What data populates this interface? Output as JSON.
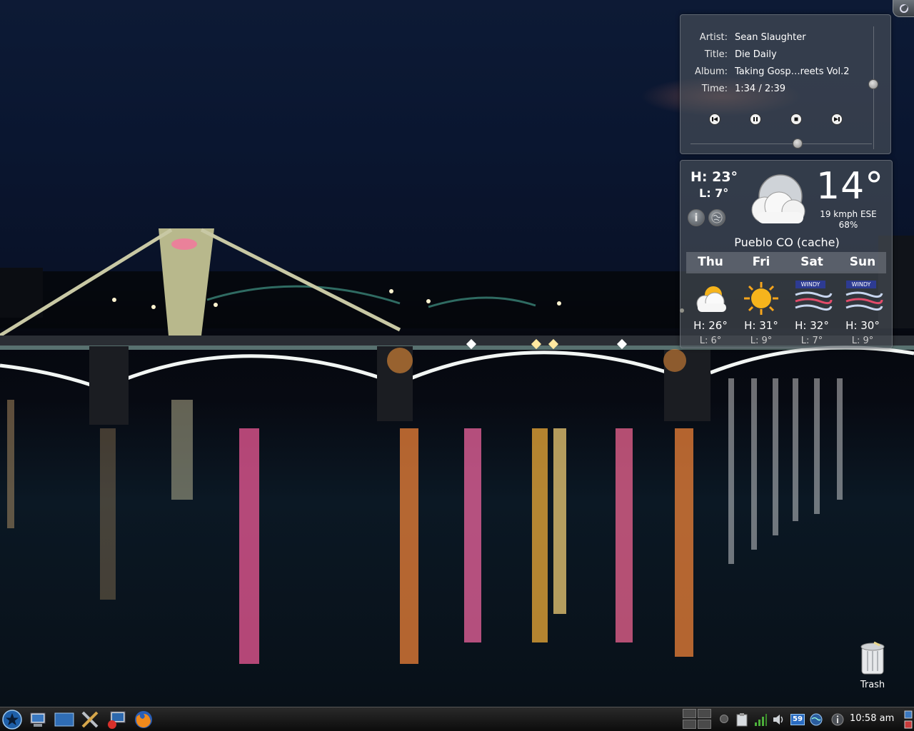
{
  "player": {
    "artist_label": "Artist:",
    "artist": "Sean Slaughter",
    "title_label": "Title:",
    "title": "Die Daily",
    "album_label": "Album:",
    "album": "Taking Gosp…reets Vol.2",
    "time_label": "Time:",
    "time": "1:34 / 2:39",
    "progress_fraction": 0.59,
    "volume_fraction": 0.53
  },
  "weather": {
    "high": "H: 23°",
    "low": "L: 7°",
    "current_temp": "14°",
    "wind": "19 kmph ESE",
    "humidity": "68%",
    "location": "Pueblo CO (cache)",
    "info_button": "i",
    "current_icon": "cloudy-icon",
    "forecast": [
      {
        "day": "Thu",
        "high": "H: 26°",
        "low": "L: 6°",
        "icon": "partly-cloudy-icon"
      },
      {
        "day": "Fri",
        "high": "H: 31°",
        "low": "L: 9°",
        "icon": "sunny-icon"
      },
      {
        "day": "Sat",
        "high": "H: 32°",
        "low": "L: 7°",
        "icon": "windy-icon",
        "tag": "WINDY"
      },
      {
        "day": "Sun",
        "high": "H: 30°",
        "low": "L: 9°",
        "icon": "windy-icon",
        "tag": "WINDY"
      }
    ]
  },
  "desktop": {
    "trash_label": "Trash"
  },
  "taskbar": {
    "clock": "10:58 am",
    "updates_badge": "59",
    "launchers": [
      "kickoff-icon",
      "system-settings-icon",
      "desktop-icon",
      "tools-icon",
      "remote-desktop-icon",
      "firefox-icon"
    ],
    "tray_icons": [
      "clipboard-icon",
      "network-signal-icon",
      "volume-icon",
      "updates-icon",
      "network-globe-icon",
      "info-icon"
    ]
  },
  "colors": {
    "panel_bg": "#4e545c",
    "taskbar_bg": "#111111",
    "windy_tag": "#2d3b92",
    "sun": "#f6b41c"
  }
}
